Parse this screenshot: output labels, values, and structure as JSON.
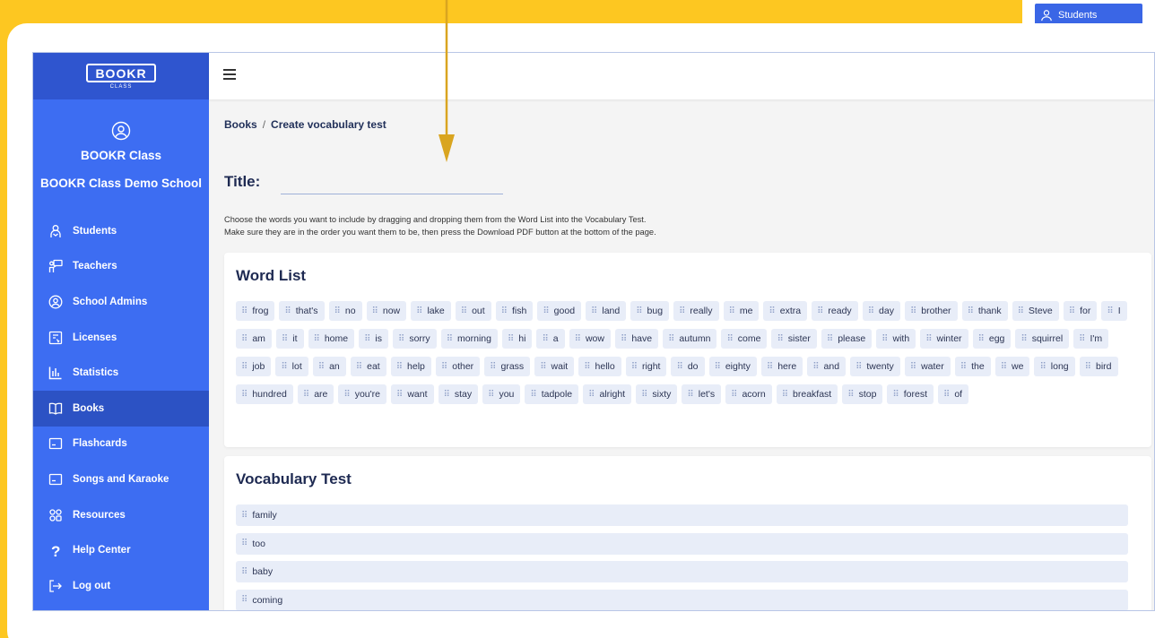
{
  "background_peek": {
    "label": "Students"
  },
  "app": {
    "logo": "BOOKR",
    "logo_sub": "CLASS",
    "profile_name": "BOOKR Class",
    "school_name": "BOOKR Class Demo School",
    "nav": [
      {
        "label": "Students",
        "icon": "students-icon"
      },
      {
        "label": "Teachers",
        "icon": "teacher-icon"
      },
      {
        "label": "School Admins",
        "icon": "admin-icon"
      },
      {
        "label": "Licenses",
        "icon": "license-icon"
      },
      {
        "label": "Statistics",
        "icon": "statistics-icon"
      },
      {
        "label": "Books",
        "icon": "book-icon",
        "active": true
      },
      {
        "label": "Flashcards",
        "icon": "flashcard-icon"
      },
      {
        "label": "Songs and Karaoke",
        "icon": "karaoke-icon"
      },
      {
        "label": "Resources",
        "icon": "resources-icon"
      },
      {
        "label": "Help Center",
        "icon": "help-icon"
      },
      {
        "label": "Log out",
        "icon": "logout-icon"
      }
    ]
  },
  "breadcrumb": {
    "parent": "Books",
    "separator": "/",
    "current": "Create vocabulary test"
  },
  "title_label": "Title:",
  "title_value": "",
  "instructions": {
    "line1": "Choose the words you want to include by dragging and dropping them from the Word List into the Vocabulary Test.",
    "line2": "Make sure they are in the order you want them to be, then press the Download PDF button at the bottom of the page."
  },
  "word_list": {
    "heading": "Word List",
    "words": [
      "frog",
      "that's",
      "no",
      "now",
      "lake",
      "out",
      "fish",
      "good",
      "land",
      "bug",
      "really",
      "me",
      "extra",
      "ready",
      "day",
      "brother",
      "thank",
      "Steve",
      "for",
      "I",
      "am",
      "it",
      "home",
      "is",
      "sorry",
      "morning",
      "hi",
      "a",
      "wow",
      "have",
      "autumn",
      "come",
      "sister",
      "please",
      "with",
      "winter",
      "egg",
      "squirrel",
      "I'm",
      "job",
      "lot",
      "an",
      "eat",
      "help",
      "other",
      "grass",
      "wait",
      "hello",
      "right",
      "do",
      "eighty",
      "here",
      "and",
      "twenty",
      "water",
      "the",
      "we",
      "long",
      "bird",
      "hundred",
      "are",
      "you're",
      "want",
      "stay",
      "you",
      "tadpole",
      "alright",
      "sixty",
      "let's",
      "acorn",
      "breakfast",
      "stop",
      "forest",
      "of"
    ]
  },
  "vocab_test": {
    "heading": "Vocabulary Test",
    "items": [
      "family",
      "too",
      "baby",
      "coming"
    ]
  },
  "colors": {
    "frame_yellow": "#fdc721",
    "sidebar_blue": "#3d6df2",
    "sidebar_active": "#2c52c4",
    "arrow": "#d9a520",
    "chip_bg": "#e8edf8"
  }
}
